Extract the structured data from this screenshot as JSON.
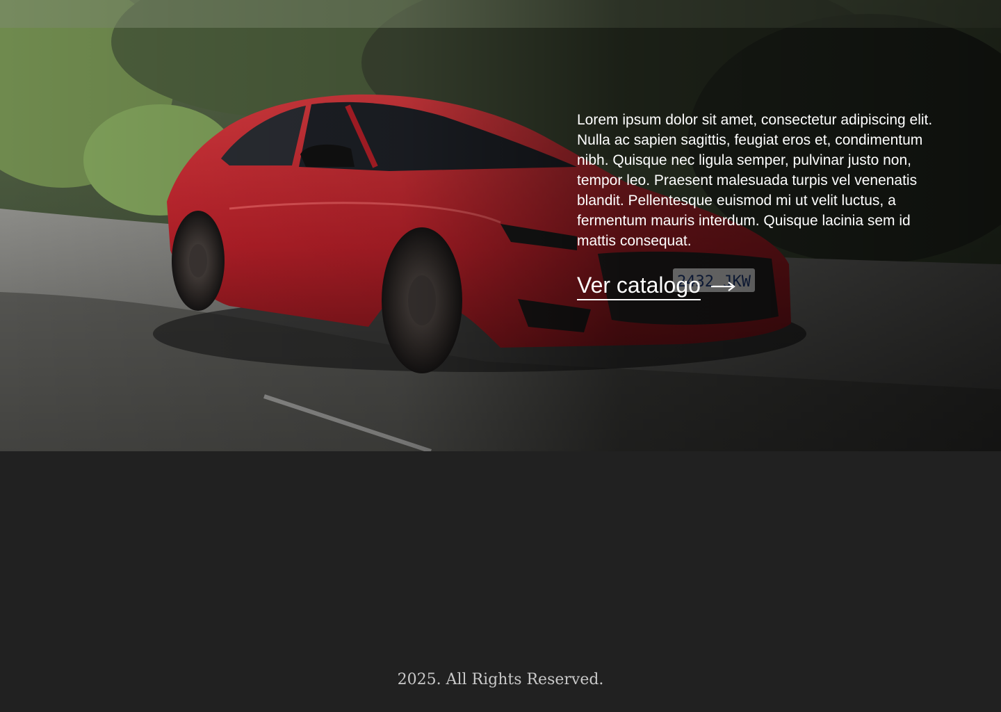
{
  "hero": {
    "description": "Lorem ipsum dolor sit amet, consectetur adipiscing elit. Nulla ac sapien sagittis, feugiat eros et, condimentum nibh. Quisque nec ligula semper, pulvinar justo non, tempor leo. Praesent malesuada turpis vel venenatis blandit. Pellentesque euismod mi ut velit luctus, a fermentum mauris interdum. Quisque lacinia sem id mattis consequat.",
    "cta_label": "Ver catalogo",
    "cta_icon": "arrow-right-icon",
    "image_plate": "2432 JKW"
  },
  "footer": {
    "copyright": "2025. All Rights Reserved."
  },
  "colors": {
    "page_background": "#212121",
    "car_red": "#c0212b",
    "text": "#ffffff"
  }
}
